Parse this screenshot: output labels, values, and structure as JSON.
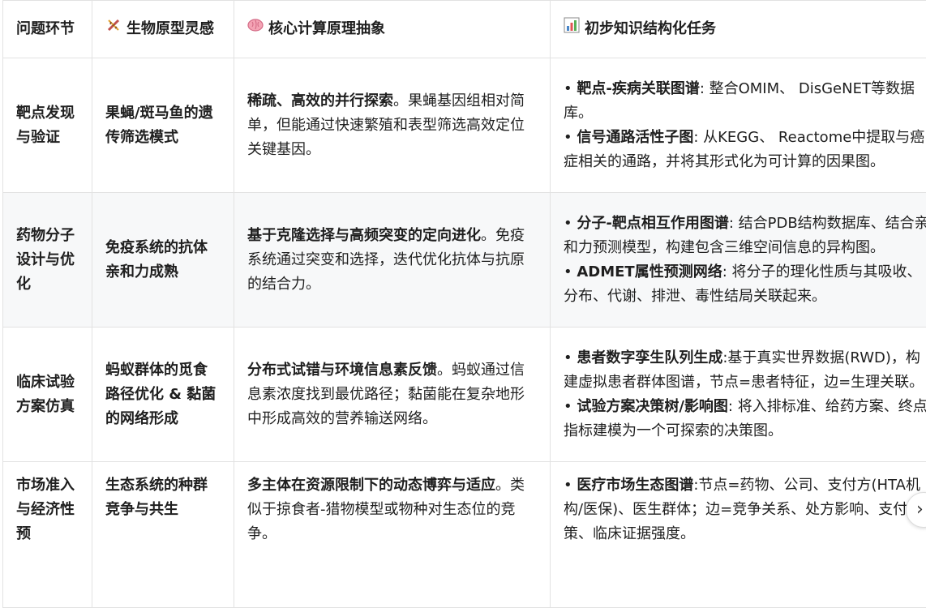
{
  "header": {
    "col_stage": "问题环节",
    "col_bio_icon": "dna-icon",
    "col_bio": "生物原型灵感",
    "col_comp_icon": "brain-icon",
    "col_comp": "核心计算原理抽象",
    "col_task_icon": "bar-chart-icon",
    "col_task": "初步知识结构化任务"
  },
  "rows": [
    {
      "stage": "靶点发现与验证",
      "bio": "果蝇/斑马鱼的遗传筛选模式",
      "comp_lead": "稀疏、高效的并行探索",
      "comp_rest": "。果蝇基因组相对简单，但能通过快速繁殖和表型筛选高效定位关键基因。",
      "task1_bold": "靶点-疾病关联图谱",
      "task1_rest": ": 整合OMIM、 DisGeNET等数据库。",
      "task2_bold": "信号通路活性子图",
      "task2_rest": ": 从KEGG、 Reactome中提取与癌症相关的通路，并将其形式化为可计算的因果图。"
    },
    {
      "stage": "药物分子设计与优化",
      "bio": "免疫系统的抗体亲和力成熟",
      "comp_lead": "基于克隆选择与高频突变的定向进化",
      "comp_rest": "。免疫系统通过突变和选择，迭代优化抗体与抗原的结合力。",
      "task1_bold": "分子-靶点相互作用图谱",
      "task1_rest": ": 结合PDB结构数据库、结合亲和力预测模型，构建包含三维空间信息的异构图。",
      "task2_bold": "ADMET属性预测网络",
      "task2_rest": ": 将分子的理化性质与其吸收、分布、代谢、排泄、毒性结局关联起来。"
    },
    {
      "stage": "临床试验方案仿真",
      "bio": "蚂蚁群体的觅食路径优化 & 黏菌的网络形成",
      "comp_lead": "分布式试错与环境信息素反馈",
      "comp_rest": "。蚂蚁通过信息素浓度找到最优路径；黏菌能在复杂地形中形成高效的营养输送网络。",
      "task1_bold": "患者数字孪生队列生成",
      "task1_rest": ":基于真实世界数据(RWD)，构建虚拟患者群体图谱，节点=患者特征，边=生理关联。",
      "task2_bold": "试验方案决策树/影响图",
      "task2_rest": ": 将入排标准、给药方案、终点指标建模为一个可探索的决策图。"
    },
    {
      "stage": "市场准入与经济性预",
      "bio": "生态系统的种群竞争与共生",
      "comp_lead": "多主体在资源限制下的动态博弈与适应",
      "comp_rest": "。类似于掠食者-猎物模型或物种对生态位的竞争。",
      "task1_bold": "医疗市场生态图谱",
      "task1_rest": ":节点=药物、公司、支付方(HTA机构/医保)、医生群体；边=竞争关系、处方影响、支付政策、临床证据强度。",
      "task2_bold": "",
      "task2_rest": ""
    }
  ],
  "scroll_button_icon": "chevron-right-icon",
  "scroll_button_glyph": "›"
}
